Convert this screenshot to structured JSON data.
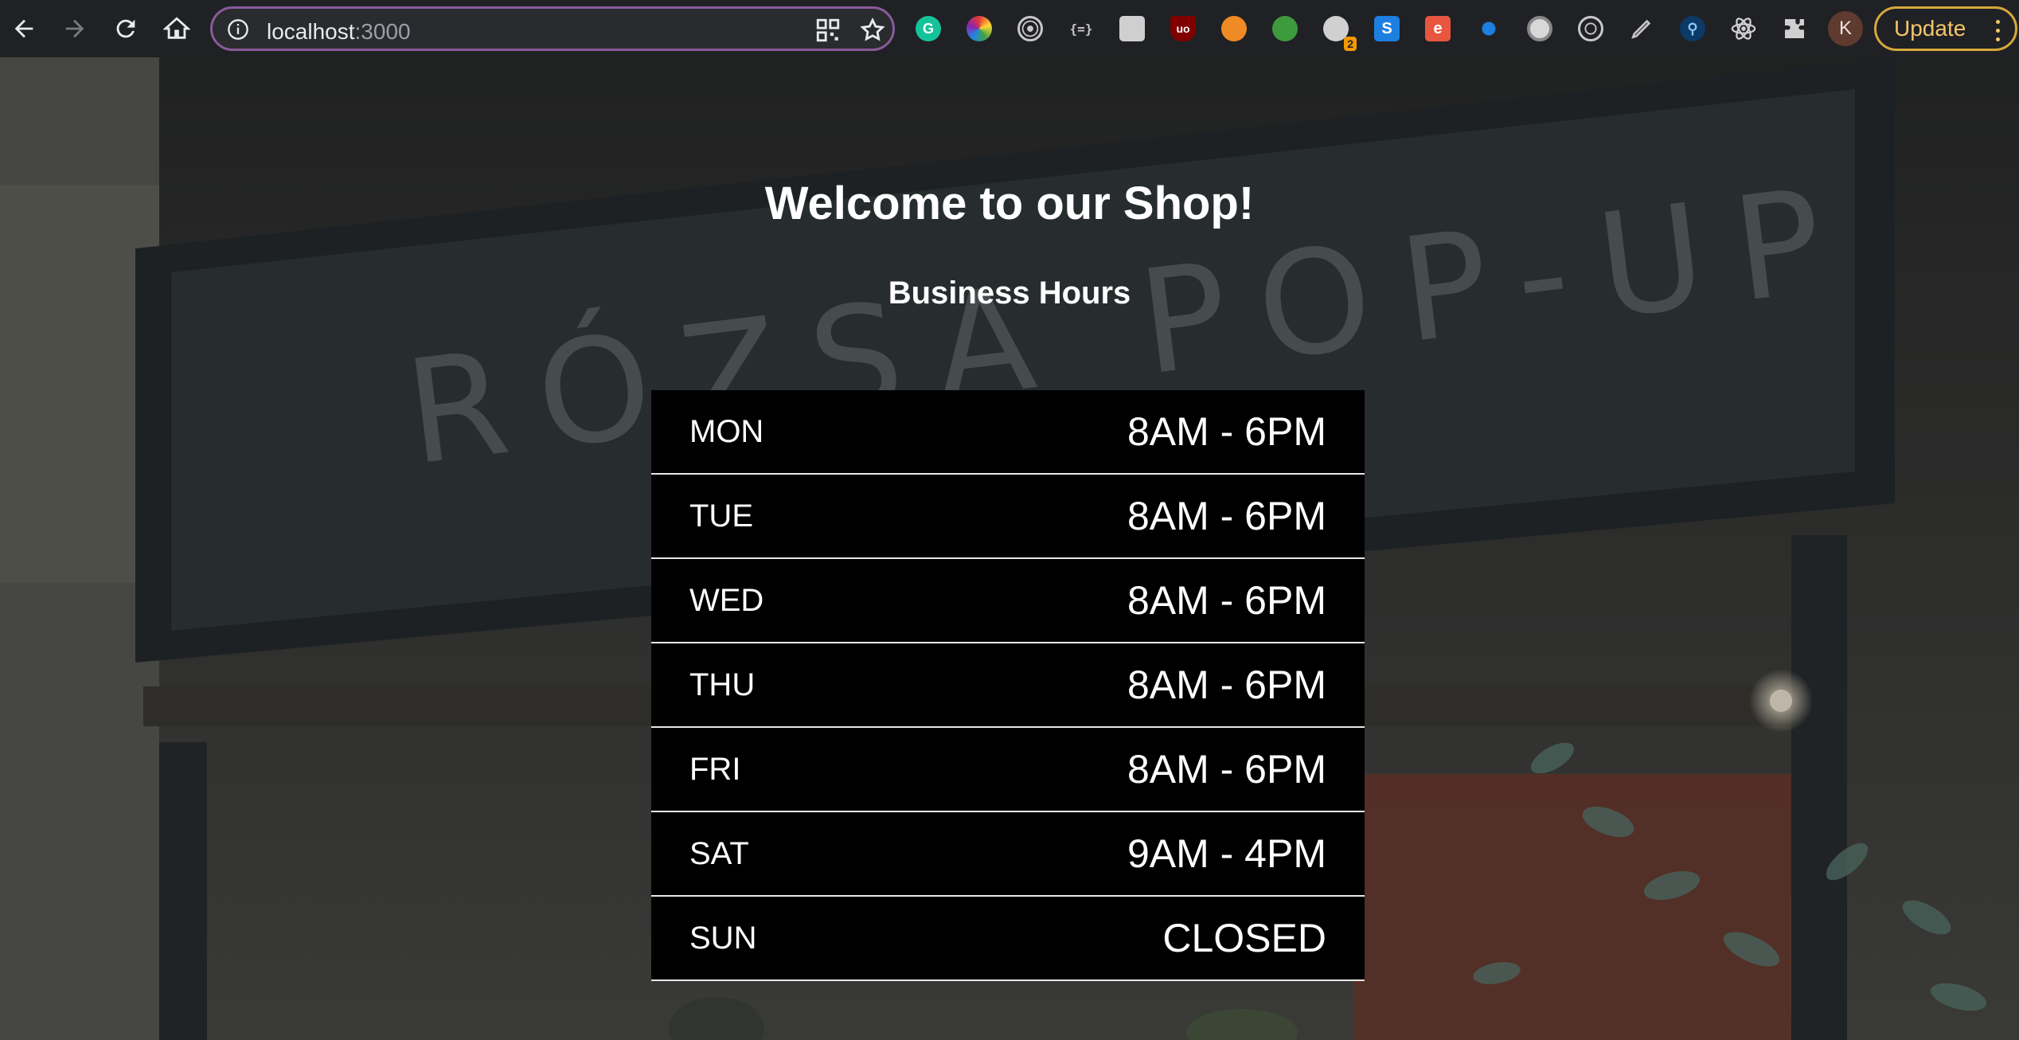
{
  "browser": {
    "url_host": "localhost",
    "url_port": ":3000",
    "extension_icons": [
      "grammarly-icon",
      "color-wheel-icon",
      "target-icon",
      "json-braces-icon",
      "notes-icon",
      "ublock-icon",
      "orange-ball-icon",
      "magnifier-icon",
      "rocket-icon",
      "s-square-icon",
      "e-square-icon",
      "bug-icon",
      "circle-icon",
      "spiral-icon",
      "pen-icon",
      "key-icon",
      "react-icon",
      "puzzle-icon"
    ],
    "extension_badge": "2",
    "extension_badge_color": "#f29900",
    "avatar_initial": "K",
    "update_label": "Update",
    "accent_color": "#d6a83c"
  },
  "page": {
    "title": "Welcome to our Shop!",
    "subtitle": "Business Hours",
    "hours": [
      {
        "day": "MON",
        "time": "8AM - 6PM"
      },
      {
        "day": "TUE",
        "time": "8AM - 6PM"
      },
      {
        "day": "WED",
        "time": "8AM - 6PM"
      },
      {
        "day": "THU",
        "time": "8AM - 6PM"
      },
      {
        "day": "FRI",
        "time": "8AM - 6PM"
      },
      {
        "day": "SAT",
        "time": "9AM - 4PM"
      },
      {
        "day": "SUN",
        "time": "CLOSED"
      }
    ],
    "background_sign_text": "RÓZSA POP-UP"
  }
}
